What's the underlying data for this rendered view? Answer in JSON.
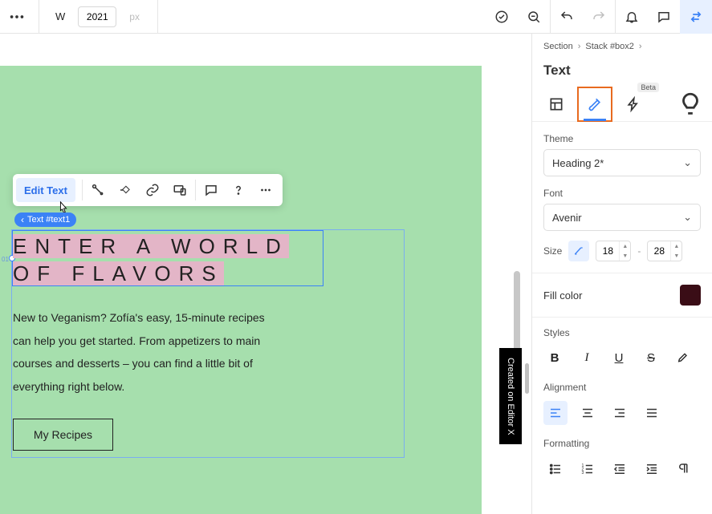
{
  "topbar": {
    "width_label": "W",
    "width_value": "2021",
    "width_unit": "px"
  },
  "floating_toolbar": {
    "edit_text": "Edit Text"
  },
  "element_label": "Text #text1",
  "canvas": {
    "ghost_dim": "01",
    "heading_html": "<span>ENTER A WORLD</span><br><span>OF FLAVORS</span>",
    "body": "New to Veganism? Zofía's easy, 15-minute recipes can help you get started. From appetizers to main courses and desserts – you can find a little bit of everything right below.",
    "button": "My Recipes",
    "watermark": "Created on Editor X"
  },
  "inspector": {
    "breadcrumb": [
      "Section",
      "Stack #box2"
    ],
    "panel_title": "Text",
    "tabs": {
      "beta_badge": "Beta"
    },
    "theme": {
      "label": "Theme",
      "value": "Heading 2*"
    },
    "font": {
      "label": "Font",
      "value": "Avenir"
    },
    "size": {
      "label": "Size",
      "min": "18",
      "max": "28",
      "dash": "-"
    },
    "fill": {
      "label": "Fill color",
      "color": "#3a0d16"
    },
    "styles": {
      "label": "Styles"
    },
    "alignment": {
      "label": "Alignment"
    },
    "formatting": {
      "label": "Formatting"
    }
  }
}
